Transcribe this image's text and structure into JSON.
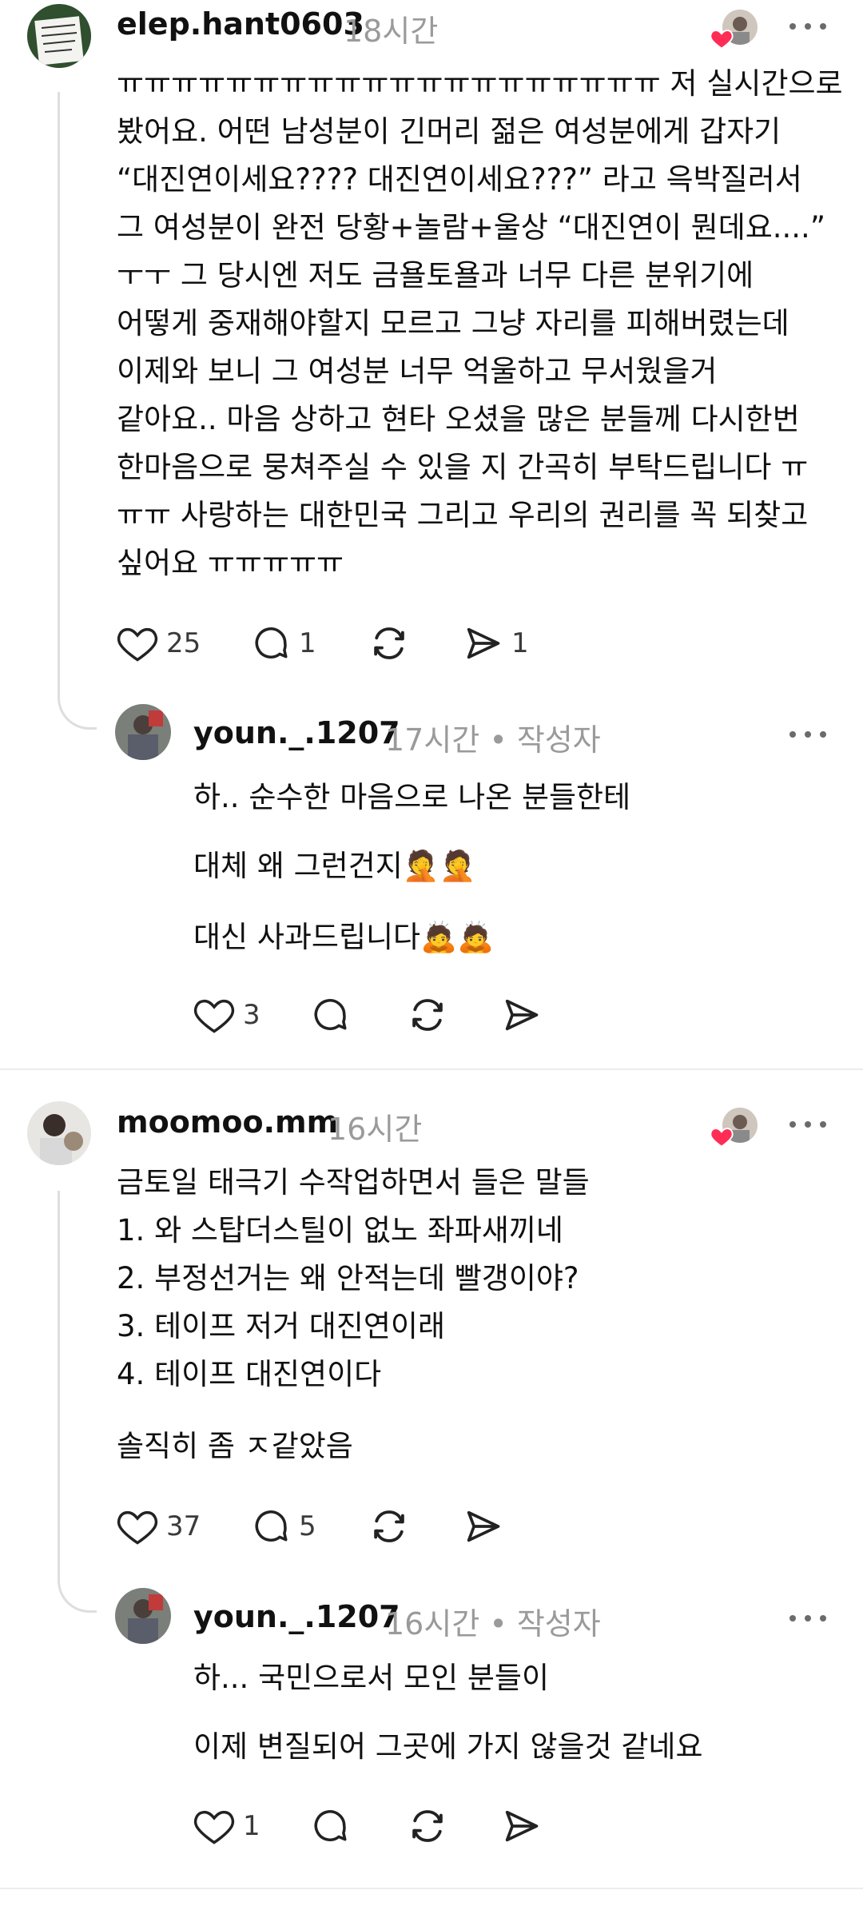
{
  "comments": [
    {
      "username": "elep.hant0603",
      "time": "18시간",
      "lines": [
        "ㅠㅠㅠㅠㅠㅠㅠㅠㅠㅠㅠㅠㅠㅠㅠㅠㅠㅠㅠㅠ 저 실시간으로",
        "봤어요. 어떤 남성분이 긴머리 젊은 여성분에게 갑자기",
        "“대진연이세요???? 대진연이세요???” 라고 윽박질러서",
        "그 여성분이 완전 당황+놀람+울상 “대진연이 뭔데요....”",
        "ㅜㅜ 그 당시엔 저도 금욜토욜과 너무 다른 분위기에",
        "어떻게 중재해야할지 모르고 그냥 자리를 피해버렸는데",
        "이제와 보니 그 여성분 너무 억울하고 무서웠을거",
        "같아요.. 마음 상하고 현타 오셨을 많은 분들께 다시한번",
        "한마음으로 뭉쳐주실 수 있을 지 간곡히 부탁드립니다 ㅠ",
        "ㅠㅠ 사랑하는 대한민국 그리고 우리의 권리를 꼭 되찾고",
        "싶어요 ㅠㅠㅠㅠㅠ"
      ],
      "likes": "25",
      "replies": "1",
      "shares": "1"
    },
    {
      "username": "youn._.1207",
      "time": "17시간 • 작성자",
      "paragraphs": [
        "하.. 순수한 마음으로 나온 분들한테",
        "대체 왜 그런건지🤦🤦",
        "대신 사과드립니다🙇🙇"
      ],
      "likes": "3"
    },
    {
      "username": "moomoo.mm",
      "time": "16시간",
      "lines": [
        "금토일 태극기 수작업하면서 들은 말들",
        "1. 와 스탑더스틸이 없노 좌파새끼네",
        "2. 부정선거는 왜 안적는데 빨갱이야?",
        "3. 테이프 저거 대진연이래",
        "4. 테이프 대진연이다"
      ],
      "extra": "솔직히 좀 ㅈ같았음",
      "likes": "37",
      "replies": "5"
    },
    {
      "username": "youn._.1207",
      "time": "16시간 • 작성자",
      "paragraphs": [
        "하... 국민으로서 모인 분들이",
        "이제 변질되어 그곳에 가지 않을것 같네요"
      ],
      "likes": "1"
    }
  ],
  "icons": {
    "like": "heart-icon",
    "reply": "speech-bubble-icon",
    "repost": "repost-icon",
    "share": "send-icon",
    "more": "more-horizontal-icon"
  },
  "colors": {
    "text": "#101010",
    "muted": "#9a9a9a",
    "heart_badge": "#ff2d55",
    "thread_line": "#dedede"
  }
}
